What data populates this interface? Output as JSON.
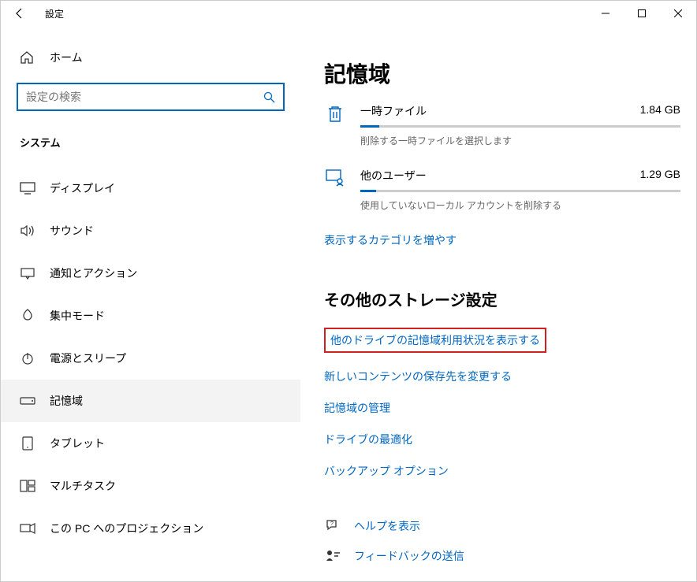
{
  "window": {
    "title": "設定"
  },
  "sidebar": {
    "home": "ホーム",
    "search_placeholder": "設定の検索",
    "category": "システム",
    "items": [
      {
        "label": "ディスプレイ"
      },
      {
        "label": "サウンド"
      },
      {
        "label": "通知とアクション"
      },
      {
        "label": "集中モード"
      },
      {
        "label": "電源とスリープ"
      },
      {
        "label": "記憶域"
      },
      {
        "label": "タブレット"
      },
      {
        "label": "マルチタスク"
      },
      {
        "label": "この PC へのプロジェクション"
      }
    ]
  },
  "main": {
    "heading": "記憶域",
    "storage": [
      {
        "title": "一時ファイル",
        "size": "1.84 GB",
        "desc": "削除する一時ファイルを選択します",
        "fill": "6%"
      },
      {
        "title": "他のユーザー",
        "size": "1.29 GB",
        "desc": "使用していないローカル アカウントを削除する",
        "fill": "5%"
      }
    ],
    "more_categories": "表示するカテゴリを増やす",
    "other_section": "その他のストレージ設定",
    "links": {
      "other_drives": "他のドライブの記憶域利用状況を表示する",
      "new_content": "新しいコンテンツの保存先を変更する",
      "manage": "記憶域の管理",
      "optimize": "ドライブの最適化",
      "backup": "バックアップ オプション"
    },
    "help": {
      "show": "ヘルプを表示",
      "feedback": "フィードバックの送信"
    }
  }
}
